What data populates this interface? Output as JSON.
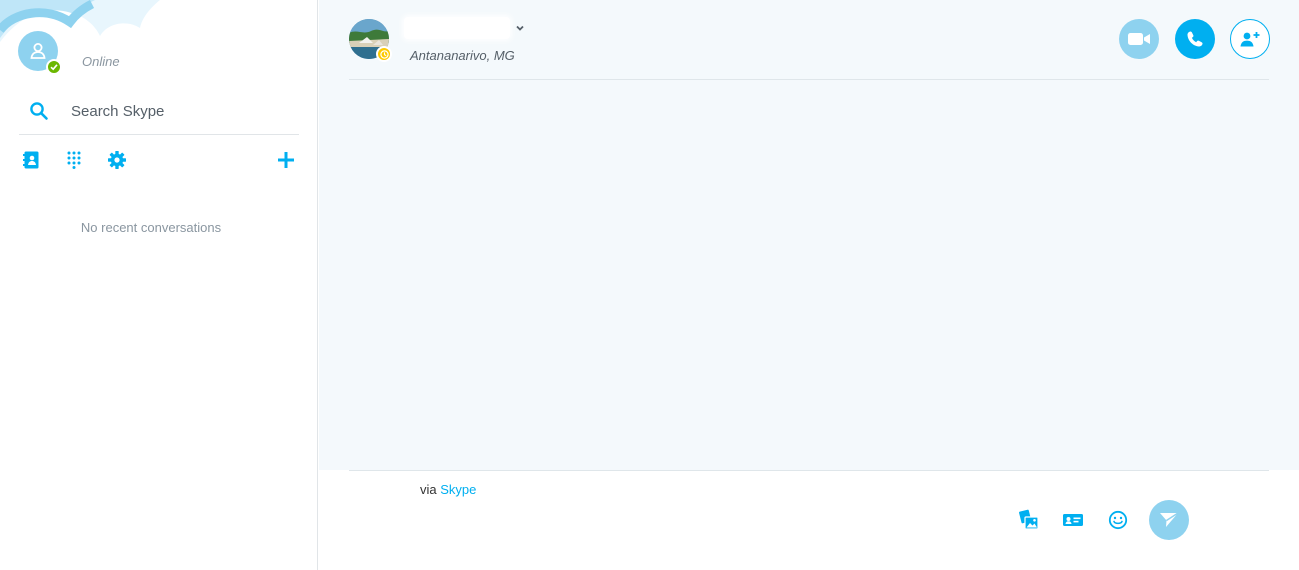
{
  "colors": {
    "accent": "#00aff0",
    "accent_light": "#8ed2ef",
    "online": "#6bb700",
    "away": "#fdc900",
    "main_bg": "#f4f9fc"
  },
  "sidebar": {
    "status_text": "Online",
    "search_placeholder": "Search Skype",
    "toolbar": {
      "contacts_icon": "contacts-book-icon",
      "dialpad_icon": "dialpad-icon",
      "settings_icon": "gear-icon",
      "add_icon": "plus-icon"
    },
    "empty_state": "No recent conversations"
  },
  "conversation": {
    "contact_location": "Antananarivo, MG",
    "presence": "away",
    "header_buttons": {
      "video_icon": "video-camera-icon",
      "call_icon": "phone-icon",
      "add_people_icon": "add-person-icon"
    }
  },
  "compose": {
    "via_prefix": "via",
    "via_link": "Skype",
    "buttons": {
      "media_icon": "send-media-icon",
      "contact_card_icon": "contact-card-icon",
      "emoticon_icon": "smiley-icon",
      "send_icon": "send-arrow-icon"
    }
  }
}
